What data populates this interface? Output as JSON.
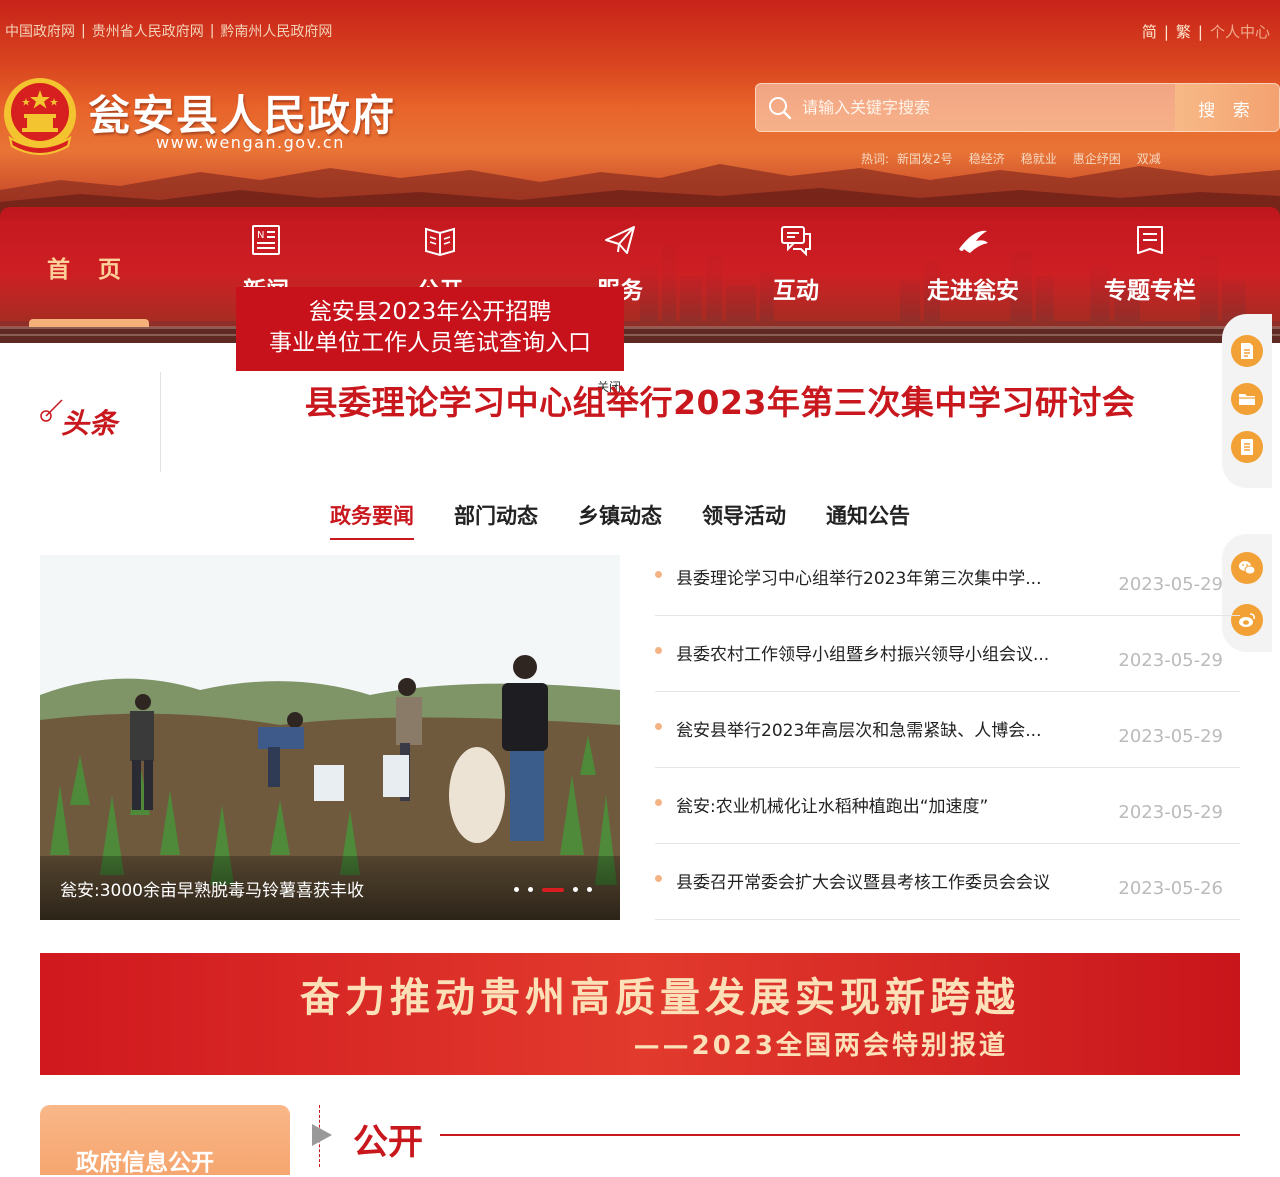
{
  "header": {
    "top_links": [
      "中国政府网",
      "贵州省人民政府网",
      "黔南州人民政府网"
    ],
    "lang_simplified": "简",
    "lang_traditional": "繁",
    "personal_center": "个人中心",
    "site_title": "瓮安县人民政府",
    "site_url": "www.wengan.gov.cn",
    "search": {
      "placeholder": "请输入关键字搜索",
      "button_label": "搜 索"
    },
    "hot": {
      "label": "热词:",
      "words": [
        "新国发2号",
        "稳经济",
        "稳就业",
        "惠企纾困",
        "双减"
      ]
    }
  },
  "nav": {
    "home": "首 页",
    "items": [
      "新闻",
      "公开",
      "服务",
      "互动",
      "走进瓮安",
      "专题专栏"
    ]
  },
  "popup": {
    "line1": "瓮安县2023年公开招聘",
    "line2": "事业单位工作人员笔试查询入口",
    "close": "关闭"
  },
  "headline": {
    "label": "头条",
    "title": "县委理论学习中心组举行2023年第三次集中学习研讨会"
  },
  "tabs": [
    "政务要闻",
    "部门动态",
    "乡镇动态",
    "领导活动",
    "通知公告"
  ],
  "slider": {
    "caption": "瓮安:3000余亩早熟脱毒马铃薯喜获丰收",
    "dot_count": 5,
    "active_index": 2
  },
  "news": [
    {
      "title": "县委理论学习中心组举行2023年第三次集中学...",
      "date": "2023-05-29"
    },
    {
      "title": "县委农村工作领导小组暨乡村振兴领导小组会议...",
      "date": "2023-05-29"
    },
    {
      "title": "瓮安县举行2023年高层次和急需紧缺、人博会...",
      "date": "2023-05-29"
    },
    {
      "title": "瓮安:农业机械化让水稻种植跑出“加速度”",
      "date": "2023-05-29"
    },
    {
      "title": "县委召开常委会扩大会议暨县考核工作委员会会议",
      "date": "2023-05-26"
    }
  ],
  "banner": {
    "line1": "奋力推动贵州高质量发展实现新跨越",
    "line2": "——2023全国两会特别报道"
  },
  "bottom": {
    "gov_card": "政府信息公开",
    "section_title": "公开"
  },
  "colors": {
    "brand_red": "#c9171e",
    "accent_orange": "#f2a136",
    "nav_home": "#ffd19a"
  }
}
